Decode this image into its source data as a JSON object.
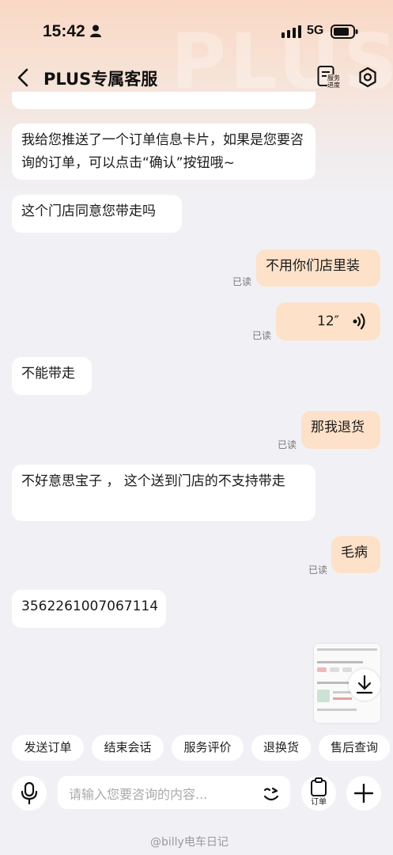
{
  "status_bar": {
    "time": "15:42",
    "network": "5G"
  },
  "header": {
    "title": "PLUS专属客服",
    "progress_label": "服务进度",
    "watermark": "PLUS"
  },
  "messages": [
    {
      "text": "我给您推送了一个订单信息卡片，如果是您要咨询的订单，可以点击“确认”按钮哦~"
    },
    {
      "text": "这个门店同意您带走吗"
    },
    {
      "text": "不用你们店里装",
      "status": "已读"
    },
    {
      "text": "12″",
      "status": "已读"
    },
    {
      "text": "不能带走"
    },
    {
      "text": "那我退货",
      "status": "已读"
    },
    {
      "text": "不好意思宝子 ， 这个送到门店的不支持带走"
    },
    {
      "text": "毛病",
      "status": "已读"
    },
    {
      "text": "3562261007067114"
    }
  ],
  "quick_actions": [
    "发送订单",
    "结束会话",
    "服务评价",
    "退换货",
    "售后查询"
  ],
  "input": {
    "placeholder": "请输入您要咨询的内容...",
    "order_label": "订单"
  },
  "watermark": "@billy电车日记",
  "colors": {
    "accent": "#fde1c8",
    "background": "#f1f1f5"
  },
  "icons": [
    "person-icon",
    "signal-icon",
    "battery-icon",
    "back-icon",
    "service-progress-icon",
    "settings-icon",
    "voice-wave-icon",
    "download-icon",
    "microphone-icon",
    "emoji-icon",
    "clipboard-icon",
    "plus-icon"
  ]
}
